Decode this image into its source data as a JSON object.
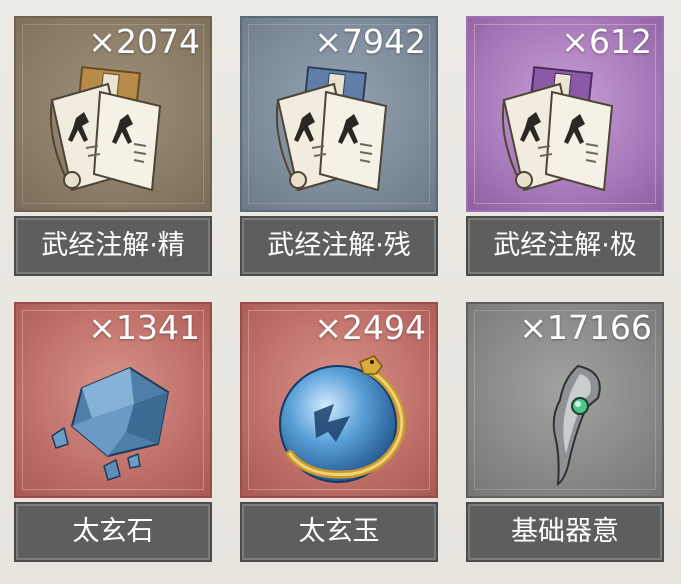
{
  "items": [
    {
      "name": "武经注解·精",
      "quantity": "×2074",
      "rarity": "brown",
      "icon": "martial-manual-icon"
    },
    {
      "name": "武经注解·残",
      "quantity": "×7942",
      "rarity": "blue",
      "icon": "martial-manual-icon"
    },
    {
      "name": "武经注解·极",
      "quantity": "×612",
      "rarity": "purple",
      "icon": "martial-manual-icon"
    },
    {
      "name": "太玄石",
      "quantity": "×1341",
      "rarity": "red",
      "icon": "blue-crystal-icon"
    },
    {
      "name": "太玄玉",
      "quantity": "×2494",
      "rarity": "red",
      "icon": "dragon-orb-icon"
    },
    {
      "name": "基础器意",
      "quantity": "×17166",
      "rarity": "gray",
      "icon": "silver-talon-icon"
    }
  ],
  "colors": {
    "brown": "#8a7c66",
    "blue": "#7d8b9a",
    "purple": "#a77ab9",
    "red": "#bf6f69",
    "gray": "#888886",
    "label_bg": "#5d5f5d"
  }
}
